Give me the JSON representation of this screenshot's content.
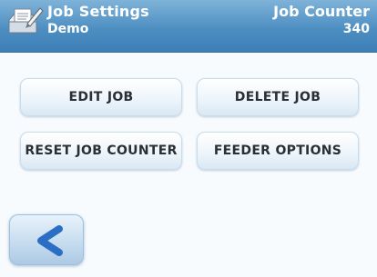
{
  "header": {
    "title": "Job Settings",
    "subtitle": "Demo",
    "counter_label": "Job Counter",
    "counter_value": "340",
    "icon": "job-settings-icon"
  },
  "buttons": {
    "edit_job": "EDIT JOB",
    "delete_job": "DELETE JOB",
    "reset_job_counter": "RESET JOB COUNTER",
    "feeder_options": "FEEDER OPTIONS"
  },
  "navigation": {
    "back_icon": "chevron-left-icon"
  },
  "colors": {
    "header_top": "#7fb3d8",
    "header_bottom": "#3c7fb6",
    "button_text": "#2a2f36",
    "back_arrow": "#2a6fc4"
  }
}
